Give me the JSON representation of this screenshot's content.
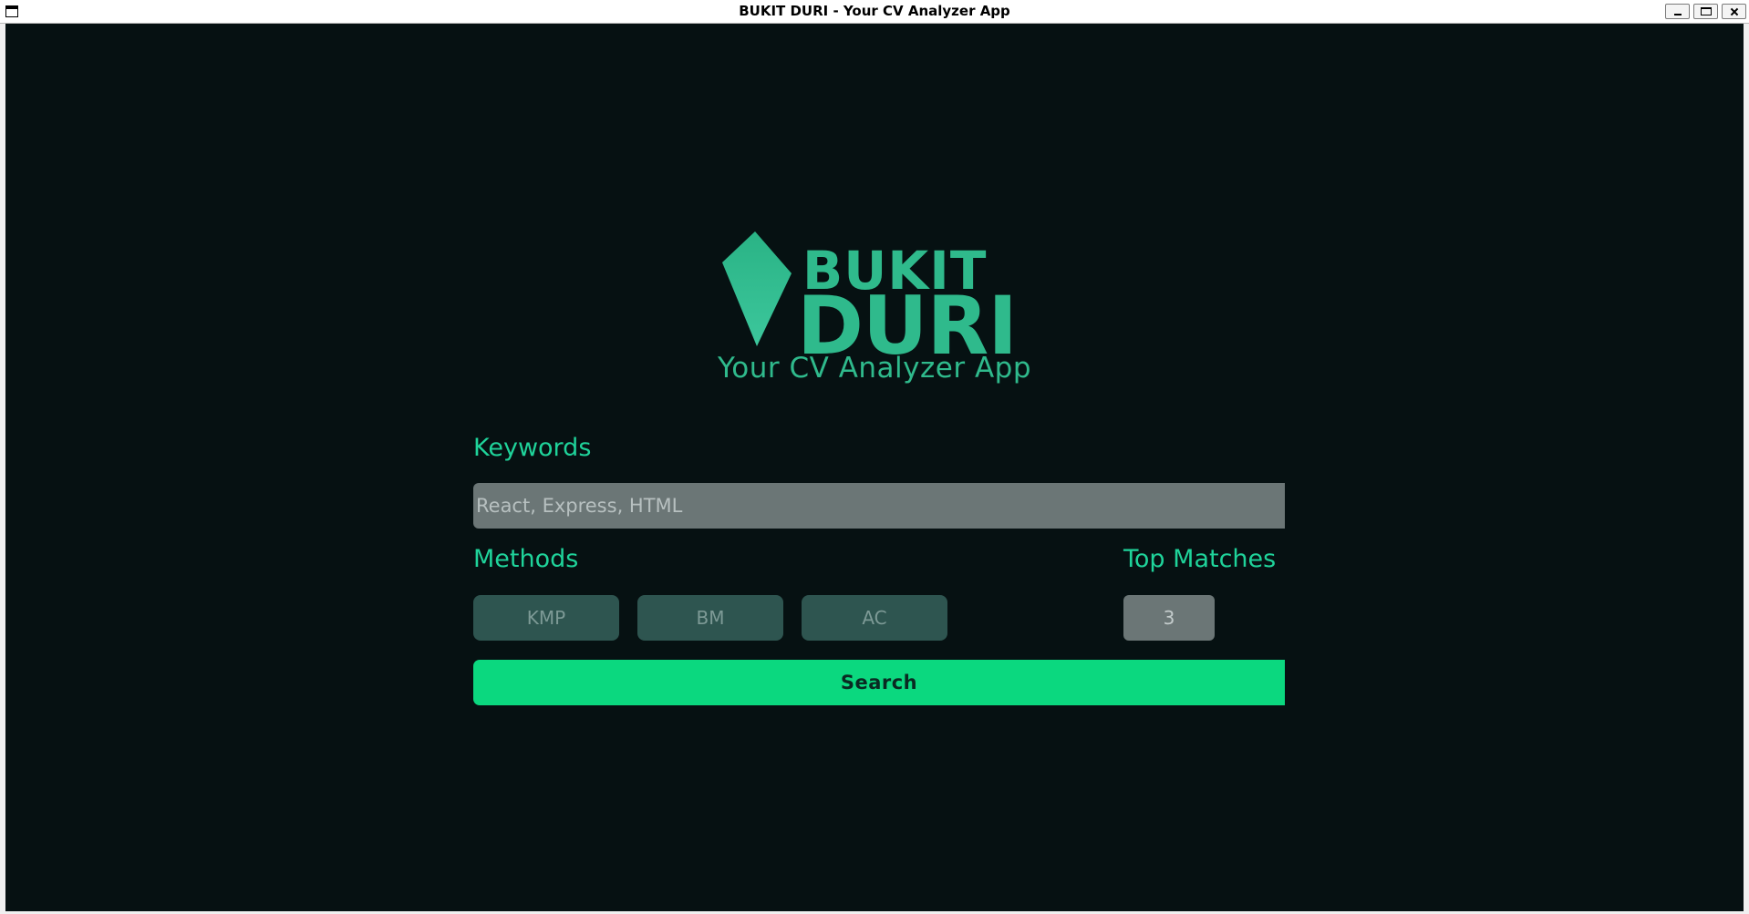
{
  "window": {
    "title": "BUKIT DURI - Your CV Analyzer App"
  },
  "logo": {
    "line1": "BUKIT",
    "line2": "DURI"
  },
  "tagline": "Your CV Analyzer App",
  "keywords": {
    "label": "Keywords",
    "placeholder": "React, Express, HTML"
  },
  "methods": {
    "label": "Methods",
    "options": [
      "KMP",
      "BM",
      "AC"
    ]
  },
  "top_matches": {
    "label": "Top Matches",
    "value": "3"
  },
  "search": {
    "label": "Search"
  },
  "colors": {
    "background": "#061112",
    "accent": "#1fd39a",
    "brand": "#2fba8c",
    "search_button": "#0bd87f",
    "method_button": "#2e5550",
    "input": "#6b7676"
  }
}
